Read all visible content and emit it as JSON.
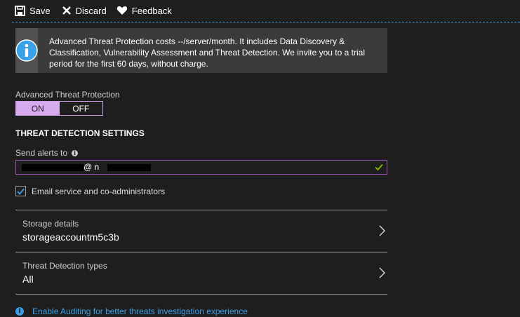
{
  "toolbar": {
    "save_label": "Save",
    "discard_label": "Discard",
    "feedback_label": "Feedback"
  },
  "info": {
    "text": "Advanced Threat Protection costs --/server/month. It includes Data Discovery & Classification, Vulnerability Assessment and Threat Detection. We invite you to a trial period for the first 60 days, without charge."
  },
  "atp": {
    "label": "Advanced Threat Protection",
    "on_label": "ON",
    "off_label": "OFF",
    "selected": "ON"
  },
  "threat_detection": {
    "section_title": "THREAT DETECTION SETTINGS",
    "send_alerts_label": "Send alerts to",
    "email_value": "@                n",
    "email_checkbox_label": "Email service and co-administrators",
    "email_checkbox_checked": true
  },
  "rows": {
    "storage_label": "Storage details",
    "storage_value": "storageaccountm5c3b",
    "types_label": "Threat Detection types",
    "types_value": "All"
  },
  "footer": {
    "link_text": "Enable Auditing for better threats investigation experience"
  },
  "colors": {
    "accent_purple": "#d7a9ee",
    "link_blue": "#3aa0e8",
    "valid_green": "#7fba00"
  }
}
